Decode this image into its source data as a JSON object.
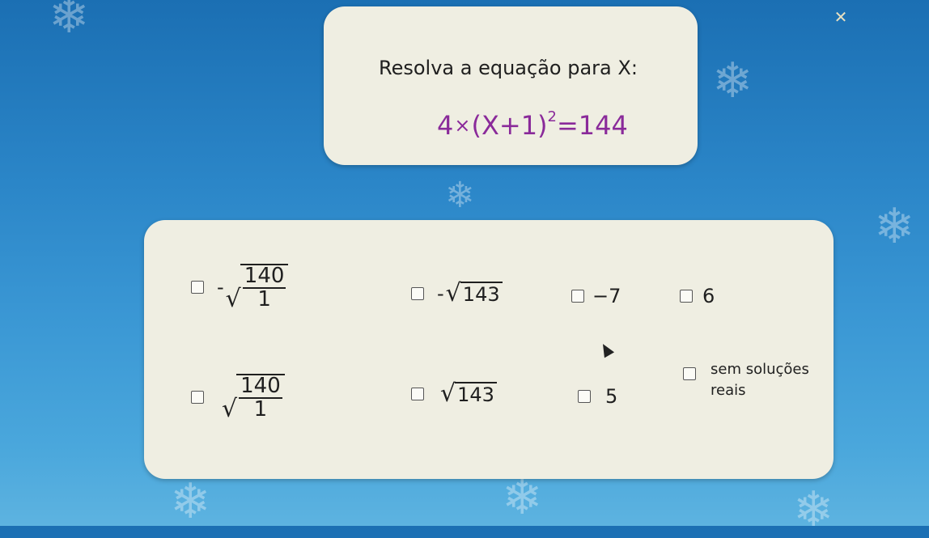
{
  "question": {
    "prompt": "Resolva a equação para X:",
    "equation": {
      "coefficient": "4",
      "times": "×",
      "base": "(X+1)",
      "exponent": "2",
      "rhs": "=144"
    }
  },
  "options": {
    "o1": {
      "minus": "-",
      "num": "140",
      "den": "1"
    },
    "o2": {
      "minus": "-",
      "radicand": "143"
    },
    "o3": {
      "label": "−7"
    },
    "o4": {
      "label": "6"
    },
    "o5": {
      "num": "140",
      "den": "1"
    },
    "o6": {
      "radicand": "143"
    },
    "o7": {
      "label": "5"
    },
    "o8": {
      "line1": "sem soluções",
      "line2": "reais"
    }
  },
  "icons": {
    "sqrt": "√",
    "close": "✕",
    "snowflake": "❄"
  },
  "colors": {
    "equation": "#8a2a9a",
    "card": "#efeee2",
    "background": "#2b86c8"
  }
}
